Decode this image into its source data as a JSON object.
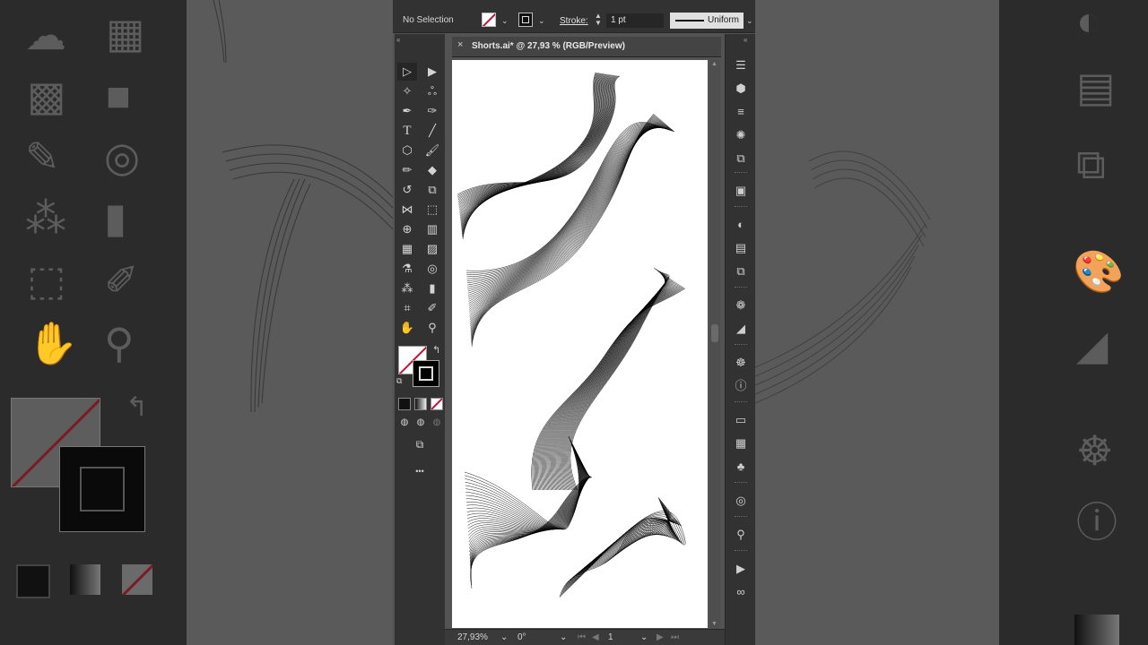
{
  "control_bar": {
    "selection_status": "No Selection",
    "stroke_label": "Stroke:",
    "stroke_weight": "1 pt",
    "stroke_profile": "Uniform"
  },
  "document_tab": {
    "title": "Shorts.ai* @ 27,93 % (RGB/Preview)"
  },
  "status_bar": {
    "zoom": "27,93%",
    "rotation": "0°",
    "artboard_number": "1"
  },
  "tools": {
    "more_label": "•••"
  },
  "colors": {
    "panel_dark": "#323232",
    "workspace": "#535353",
    "artboard": "#ffffff",
    "none_slash": "#c8102e"
  }
}
